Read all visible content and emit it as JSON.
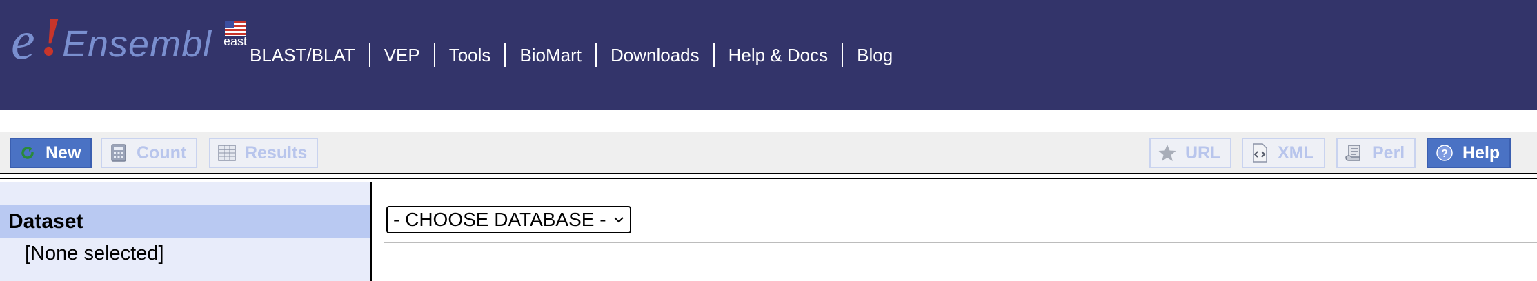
{
  "header": {
    "logo": {
      "e": "e",
      "bang": "!",
      "word": "Ensembl",
      "region": "east"
    },
    "nav": [
      {
        "label": "BLAST/BLAT"
      },
      {
        "label": "VEP"
      },
      {
        "label": "Tools"
      },
      {
        "label": "BioMart"
      },
      {
        "label": "Downloads"
      },
      {
        "label": "Help & Docs"
      },
      {
        "label": "Blog"
      }
    ]
  },
  "toolbar": {
    "new_label": "New",
    "count_label": "Count",
    "results_label": "Results",
    "url_label": "URL",
    "xml_label": "XML",
    "perl_label": "Perl",
    "help_label": "Help"
  },
  "sidebar": {
    "dataset_heading": "Dataset",
    "dataset_value": "[None selected]"
  },
  "main": {
    "database_select": {
      "value": "- CHOOSE DATABASE -"
    }
  },
  "colors": {
    "header_bg": "#33346a",
    "accent_button": "#4a72c4",
    "disabled_text": "#b8c5ec",
    "sidebar_bg": "#e8ecfa",
    "sidebar_heading_bg": "#b9c9f2"
  }
}
